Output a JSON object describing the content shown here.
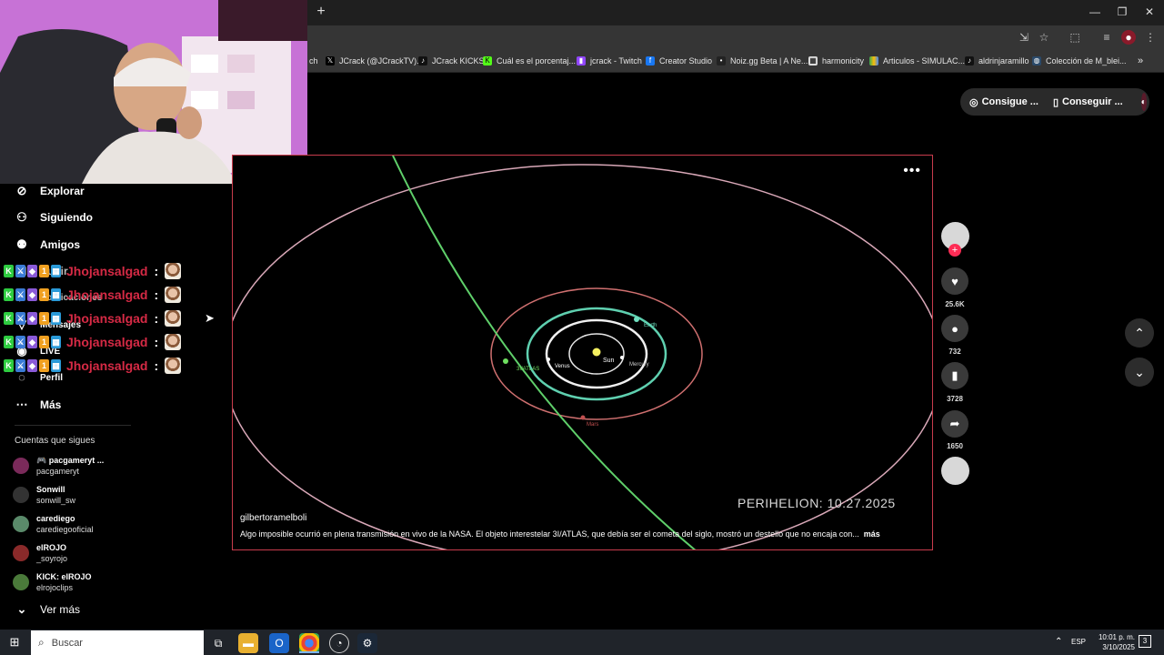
{
  "browser": {
    "new_tab": "+",
    "window_controls": [
      "—",
      "❐",
      "✕"
    ],
    "bookmarks": [
      {
        "label": "ch",
        "icon": "tiktok-icon"
      },
      {
        "label": "JCrack (@JCrackTV)...",
        "icon": "x-icon"
      },
      {
        "label": "JCrack KICKS",
        "icon": "tiktok-icon"
      },
      {
        "label": "Cuál es el porcentaj...",
        "icon": "kick-icon"
      },
      {
        "label": "jcrack - Twitch",
        "icon": "twitch-icon"
      },
      {
        "label": "Creator Studio",
        "icon": "facebook-icon"
      },
      {
        "label": "Noiz.gg Beta | A Ne...",
        "icon": "noiz-icon"
      },
      {
        "label": "harmonicity",
        "icon": "harmonicity-icon"
      },
      {
        "label": "Articulos - SIMULAC...",
        "icon": "drive-icon"
      },
      {
        "label": "aldrinjaramillo",
        "icon": "tiktok-icon"
      },
      {
        "label": "Colección de M_blei...",
        "icon": "globe-icon"
      }
    ],
    "bookmarks_more": "»"
  },
  "topbar": {
    "coins_label": "Consigue ...",
    "app_label": "Conseguir ..."
  },
  "sidebar": {
    "nav": [
      {
        "label": "Explorar",
        "icon": "compass-icon"
      },
      {
        "label": "Siguiendo",
        "icon": "following-icon"
      },
      {
        "label": "Amigos",
        "icon": "friends-icon"
      },
      {
        "label": "Subir",
        "icon": "upload-icon"
      },
      {
        "label": "Notificaciones",
        "icon": "bell-icon"
      },
      {
        "label": "Mensajes",
        "icon": "messages-icon"
      },
      {
        "label": "LIVE",
        "icon": "live-icon"
      },
      {
        "label": "Perfil",
        "icon": "profile-icon"
      },
      {
        "label": "Más",
        "icon": "more-icon"
      }
    ],
    "following_title": "Cuentas que sigues",
    "accounts": [
      {
        "name": "🎮 pacgameryt ...",
        "handle": "pacgameryt",
        "color": "#7a2a5a"
      },
      {
        "name": "Sonwill",
        "handle": "sonwill_sw",
        "color": "#333333"
      },
      {
        "name": "carediego",
        "handle": "carediegooficial",
        "color": "#5a8a6a"
      },
      {
        "name": "elROJO",
        "handle": "_soyrojo",
        "color": "#8a2a2a"
      },
      {
        "name": "KICK: elROJO",
        "handle": "elrojoclips",
        "color": "#4a7a3a"
      }
    ],
    "see_more": "Ver más"
  },
  "chat": {
    "username": "Jhojansalgad",
    "colon": ":",
    "rows": 5,
    "name_color": "#d62a45"
  },
  "video": {
    "author": "gilbertoramelboli",
    "description": "Algo imposible ocurrió en plena transmisión en vivo de la NASA. El objeto interestelar 3I/ATLAS, que debía ser el cometa del siglo, mostró un destello que no encaja con...",
    "more": "más",
    "overlay_text": "PERIHELION: 10.27.2025",
    "labels": {
      "sun": "Sun",
      "venus": "Venus",
      "mercury": "Mercury",
      "earth": "Earth",
      "mars": "Mars",
      "atlas": "3I/ATLAS"
    }
  },
  "actions": {
    "likes": "25.6K",
    "comments": "732",
    "saves": "3728",
    "shares": "1650"
  },
  "taskbar": {
    "search_placeholder": "Buscar",
    "language": "ESP",
    "time": "10:01 p. m.",
    "date": "3/10/2025",
    "notification_count": "3"
  },
  "colors": {
    "accent": "#fe2c55",
    "video_border": "#c83c4c",
    "page_bg": "#000000"
  }
}
